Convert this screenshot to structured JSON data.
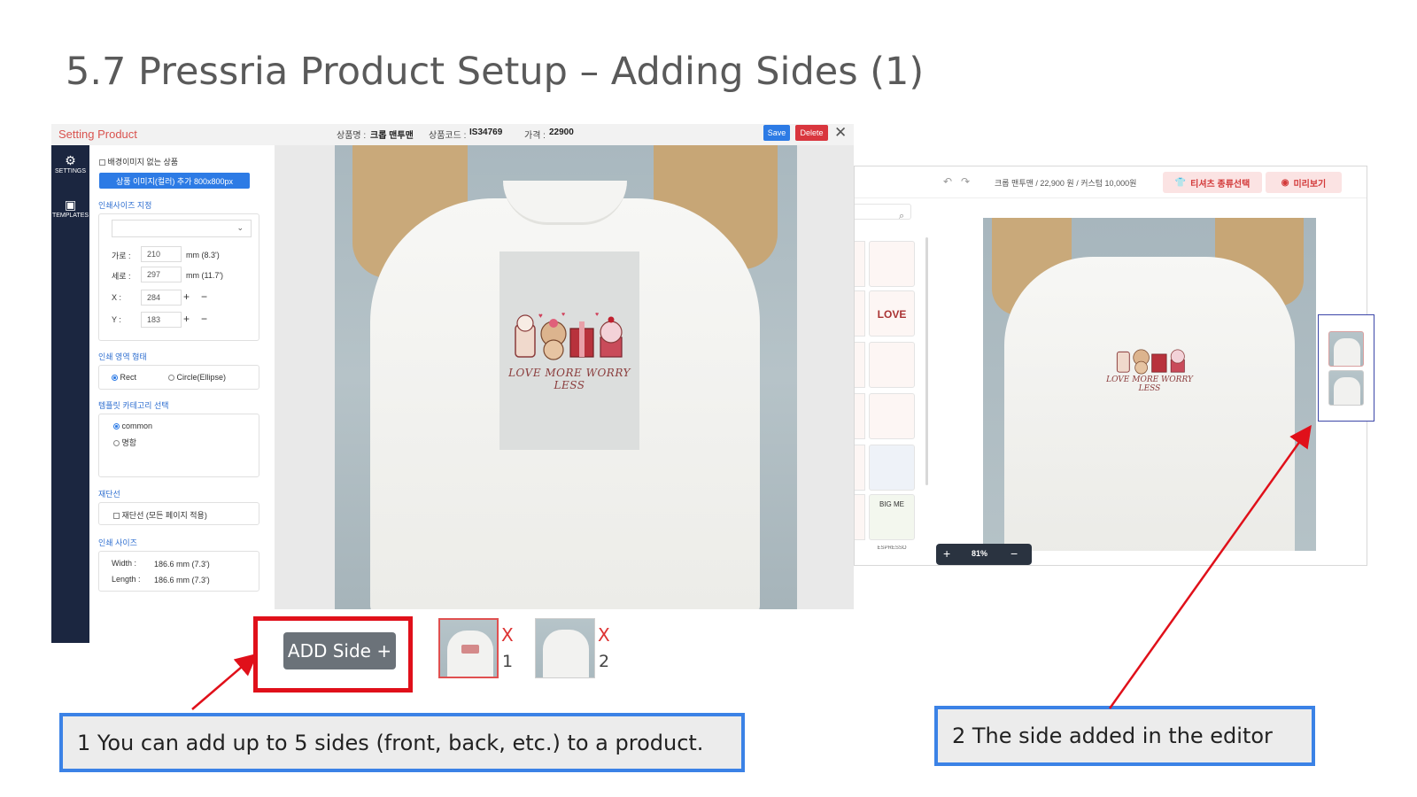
{
  "slide": {
    "title": "5.7 Pressria Product Setup – Adding Sides (1)"
  },
  "setting_window": {
    "title": "Setting Product",
    "product_name_label": "상품명 :",
    "product_name": "크롭 맨투맨",
    "product_code_label": "상품코드 :",
    "product_code": "IS34769",
    "price_label": "가격 :",
    "price": "22900",
    "save_label": "Save",
    "delete_label": "Delete",
    "close_glyph": "✕",
    "rail": {
      "settings_label": "SETTINGS",
      "templates_label": "TEMPLATES"
    },
    "form": {
      "no_bg_label": "배경이미지 없는 상품",
      "add_image_button": "상품 이미지(컬러) 추가 800x800px",
      "print_size_heading": "인쇄사이즈 지정",
      "width_label": "가로 :",
      "width_value": "210",
      "width_unit": "mm (8.3')",
      "height_label": "세로 :",
      "height_value": "297",
      "height_unit": "mm (11.7')",
      "x_label": "X :",
      "x_value": "284",
      "y_label": "Y :",
      "y_value": "183",
      "plus": "+",
      "minus": "−",
      "area_shape_heading": "인쇄 영역 형태",
      "shape_rect": "Rect",
      "shape_circle": "Circle(Ellipse)",
      "template_category_heading": "템플릿 카테고리 선택",
      "category_common": "common",
      "category_name": "명함",
      "cut_line_heading": "재단선",
      "cut_line_option": "재단선 (모든 페이지 적용)",
      "print_size_summary_heading": "인쇄 사이즈",
      "summary_width_label": "Width :",
      "summary_width_value": "186.6 mm (7.3')",
      "summary_length_label": "Length :",
      "summary_length_value": "186.6 mm (7.3')"
    },
    "art_text": "LOVE MORE WORRY LESS"
  },
  "sides": {
    "add_button": "ADD Side +",
    "items": [
      {
        "remove": "X",
        "number": "1"
      },
      {
        "remove": "X",
        "number": "2"
      }
    ]
  },
  "callouts": {
    "one": "1 You can add up to 5 sides (front, back, etc.) to a product.",
    "two": "2 The side added in the editor"
  },
  "editor": {
    "info": "크롭 맨투맨 / 22,900 원 / 커스텀 10,000원",
    "tshirt_select": "티셔츠 종류선택",
    "preview": "미리보기",
    "zoom": "81%",
    "zoom_plus": "+",
    "zoom_minus": "−",
    "art_text": "LOVE MORE WORRY LESS",
    "templates": [
      "LOVE",
      "BIG ME",
      "ESPRESSO"
    ]
  },
  "colors": {
    "annotation_red": "#e0101a",
    "callout_border": "#3b82e6",
    "save_blue": "#2d7be5",
    "delete_red": "#d9363e",
    "rail_navy": "#1b2640"
  },
  "icons": [
    "gear-icon",
    "templates-icon",
    "close-icon",
    "chevron-down-icon",
    "undo-icon",
    "redo-icon",
    "search-icon",
    "tshirt-icon",
    "eye-icon"
  ]
}
